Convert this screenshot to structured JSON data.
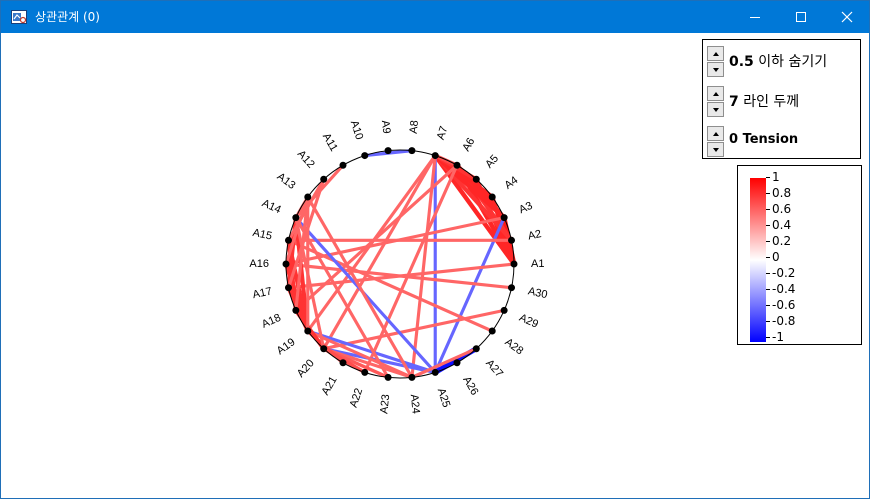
{
  "window": {
    "title": "상관관계 (0)"
  },
  "titlebar_buttons": [
    {
      "name": "minimize-button",
      "icon": "minimize-icon"
    },
    {
      "name": "maximize-button",
      "icon": "maximize-icon"
    },
    {
      "name": "close-button",
      "icon": "close-icon"
    }
  ],
  "controls": [
    {
      "value": "0.5",
      "label": "이하 숨기기"
    },
    {
      "value": "7",
      "label": "라인 두께"
    },
    {
      "value": "0",
      "label": "Tension"
    }
  ],
  "legend": {
    "ticks": [
      "1",
      "0.8",
      "0.6",
      "0.4",
      "0.2",
      "0",
      "-0.2",
      "-0.4",
      "-0.6",
      "-0.8",
      "-1"
    ],
    "colors": {
      "max": "#ff0000",
      "zero": "#ffffff",
      "min": "#0000ff"
    }
  },
  "nodes": [
    "A1",
    "A2",
    "A3",
    "A4",
    "A5",
    "A6",
    "A7",
    "A8",
    "A9",
    "A10",
    "A11",
    "A12",
    "A13",
    "A14",
    "A15",
    "A16",
    "A17",
    "A18",
    "A19",
    "A20",
    "A21",
    "A22",
    "A23",
    "A24",
    "A25",
    "A26",
    "A27",
    "A28",
    "A29",
    "A30"
  ],
  "links": [
    {
      "from": "A1",
      "to": "A3",
      "r": 0.9
    },
    {
      "from": "A1",
      "to": "A4",
      "r": 0.85
    },
    {
      "from": "A1",
      "to": "A5",
      "r": 0.85
    },
    {
      "from": "A1",
      "to": "A6",
      "r": 0.85
    },
    {
      "from": "A1",
      "to": "A7",
      "r": 0.85
    },
    {
      "from": "A2",
      "to": "A6",
      "r": 0.8
    },
    {
      "from": "A2",
      "to": "A7",
      "r": 0.8
    },
    {
      "from": "A3",
      "to": "A6",
      "r": 0.85
    },
    {
      "from": "A3",
      "to": "A7",
      "r": 0.85
    },
    {
      "from": "A4",
      "to": "A7",
      "r": 0.85
    },
    {
      "from": "A5",
      "to": "A7",
      "r": 0.8
    },
    {
      "from": "A6",
      "to": "A7",
      "r": 0.7
    },
    {
      "from": "A8",
      "to": "A10",
      "r": -0.6
    },
    {
      "from": "A7",
      "to": "A25",
      "r": -0.6
    },
    {
      "from": "A7",
      "to": "A19",
      "r": 0.6
    },
    {
      "from": "A7",
      "to": "A20",
      "r": 0.6
    },
    {
      "from": "A7",
      "to": "A24",
      "r": 0.6
    },
    {
      "from": "A6",
      "to": "A18",
      "r": 0.6
    },
    {
      "from": "A6",
      "to": "A22",
      "r": 0.6
    },
    {
      "from": "A3",
      "to": "A25",
      "r": -0.6
    },
    {
      "from": "A3",
      "to": "A16",
      "r": 0.6
    },
    {
      "from": "A2",
      "to": "A15",
      "r": 0.6
    },
    {
      "from": "A1",
      "to": "A17",
      "r": 0.6
    },
    {
      "from": "A30",
      "to": "A16",
      "r": 0.6
    },
    {
      "from": "A29",
      "to": "A20",
      "r": 0.6
    },
    {
      "from": "A28",
      "to": "A15",
      "r": 0.6
    },
    {
      "from": "A25",
      "to": "A27",
      "r": -0.95
    },
    {
      "from": "A25",
      "to": "A14",
      "r": -0.6
    },
    {
      "from": "A25",
      "to": "A20",
      "r": -0.6
    },
    {
      "from": "A25",
      "to": "A19",
      "r": -0.6
    },
    {
      "from": "A24",
      "to": "A19",
      "r": 0.6
    },
    {
      "from": "A24",
      "to": "A20",
      "r": 0.6
    },
    {
      "from": "A24",
      "to": "A13",
      "r": 0.6
    },
    {
      "from": "A24",
      "to": "A27",
      "r": 0.6
    },
    {
      "from": "A23",
      "to": "A20",
      "r": 0.65
    },
    {
      "from": "A23",
      "to": "A14",
      "r": 0.6
    },
    {
      "from": "A22",
      "to": "A20",
      "r": 0.7
    },
    {
      "from": "A21",
      "to": "A19",
      "r": 0.7
    },
    {
      "from": "A14",
      "to": "A19",
      "r": 0.8
    },
    {
      "from": "A15",
      "to": "A19",
      "r": 0.8
    },
    {
      "from": "A16",
      "to": "A19",
      "r": 0.8
    },
    {
      "from": "A17",
      "to": "A19",
      "r": 0.8
    },
    {
      "from": "A18",
      "to": "A20",
      "r": 0.8
    },
    {
      "from": "A14",
      "to": "A17",
      "r": 0.8
    },
    {
      "from": "A15",
      "to": "A18",
      "r": 0.8
    },
    {
      "from": "A13",
      "to": "A16",
      "r": 0.6
    },
    {
      "from": "A13",
      "to": "A14",
      "r": 0.6
    },
    {
      "from": "A11",
      "to": "A14",
      "r": 0.6
    },
    {
      "from": "A12",
      "to": "A15",
      "r": 0.6
    },
    {
      "from": "A13",
      "to": "A18",
      "r": 0.6
    },
    {
      "from": "A13",
      "to": "A19",
      "r": 0.6
    },
    {
      "from": "A14",
      "to": "A20",
      "r": 0.6
    },
    {
      "from": "A12",
      "to": "A17",
      "r": 0.6
    }
  ]
}
